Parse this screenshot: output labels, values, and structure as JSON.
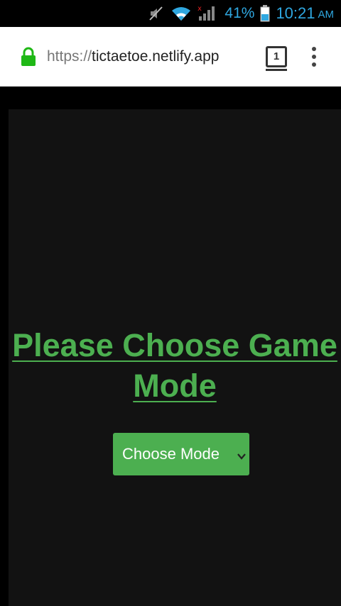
{
  "status_bar": {
    "battery_percent": "41%",
    "time": "10:21",
    "ampm": "AM",
    "icons": [
      "mute-icon",
      "wifi-icon",
      "signal-icon",
      "battery-icon"
    ]
  },
  "browser": {
    "url_scheme": "https://",
    "url_host": "tictaetoe.netlify.app",
    "tab_count": "1",
    "lock_color": "#1fb816"
  },
  "page": {
    "title": "Please Choose Game Mode",
    "select": {
      "selected_label": "Choose Mode"
    },
    "accent_color": "#4caf50",
    "panel_color": "#121212"
  }
}
